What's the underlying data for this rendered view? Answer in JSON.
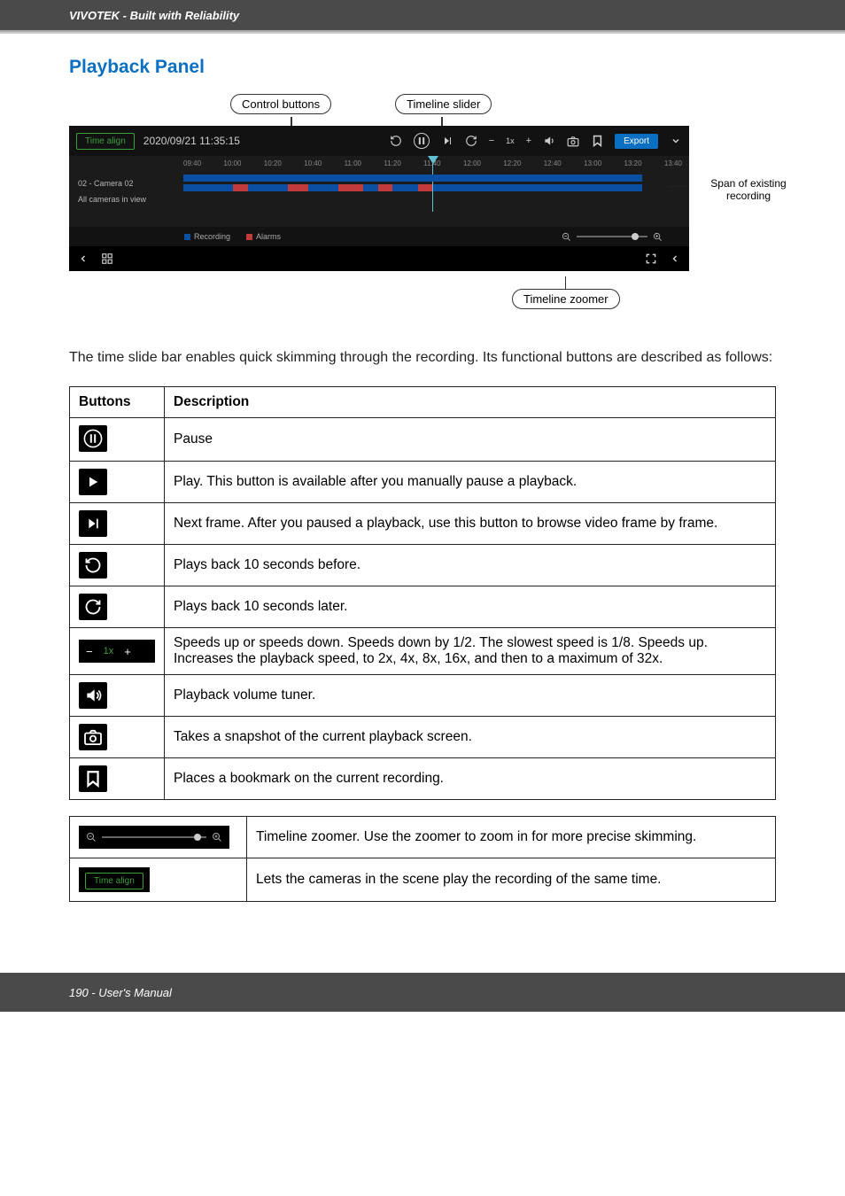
{
  "header": {
    "brand": "VIVOTEK - Built with Reliability"
  },
  "section_title": "Playback Panel",
  "callouts": {
    "control": "Control buttons",
    "slider": "Timeline slider",
    "span": "Span of existing recording",
    "zoomer": "Timeline zoomer"
  },
  "player": {
    "time_align": "Time align",
    "timestamp": "2020/09/21 11:35:15",
    "speed": "1x",
    "export": "Export",
    "camera": "02 - Camera 02",
    "all_cams": "All cameras in view",
    "legend_recording": "Recording",
    "legend_alarms": "Alarms",
    "ticks": [
      "09:40",
      "10:00",
      "10:20",
      "10:40",
      "11:00",
      "11:20",
      "11:40",
      "12:00",
      "12:20",
      "12:40",
      "13:00",
      "13:20",
      "13:40"
    ]
  },
  "body_text": "The time slide bar enables quick skimming through the recording. Its functional buttons are described as follows:",
  "table": {
    "h_btn": "Buttons",
    "h_desc": "Description",
    "rows": [
      {
        "k": "pause",
        "d": "Pause"
      },
      {
        "k": "play",
        "d": "Play. This button is available after you manually pause a playback."
      },
      {
        "k": "next",
        "d": "Next frame. After you paused a playback, use this button to browse video frame by frame."
      },
      {
        "k": "rewind10",
        "d": "Plays back 10 seconds before."
      },
      {
        "k": "fwd10",
        "d": "Plays back 10 seconds later."
      },
      {
        "k": "speed",
        "d": "Speeds up or speeds down. Speeds down by 1/2. The slowest speed is 1/8. Speeds up. Increases the playback speed, to 2x, 4x, 8x, 16x, and then to a maximum of 32x."
      },
      {
        "k": "volume",
        "d": "Playback volume tuner."
      },
      {
        "k": "snapshot",
        "d": "Takes a snapshot of the current playback screen."
      },
      {
        "k": "bookmark",
        "d": "Places a bookmark on the current recording."
      }
    ]
  },
  "table2": {
    "zoomer_desc": "Timeline zoomer. Use the zoomer to zoom in for more precise skimming.",
    "timealign_desc": "Lets the cameras in the scene play the recording of the same time."
  },
  "speed_widget": {
    "minus": "−",
    "val": "1x",
    "plus": "+"
  },
  "footer": "190 - User's Manual"
}
